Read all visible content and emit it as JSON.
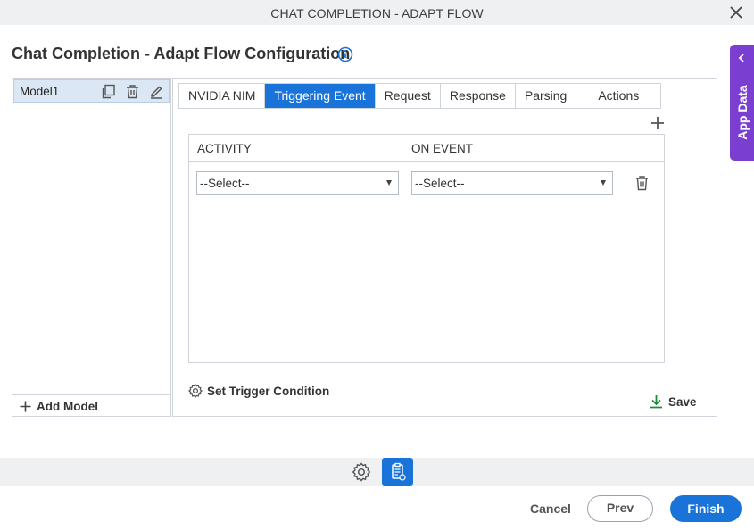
{
  "window": {
    "title": "CHAT COMPLETION - ADAPT FLOW",
    "close_icon": "close-icon"
  },
  "page": {
    "heading": "Chat Completion - Adapt Flow Configuration",
    "info_icon": "info-icon"
  },
  "side_tab": {
    "label": "App Data",
    "color": "#7a3fd1"
  },
  "models": {
    "items": [
      {
        "label": "Model1"
      }
    ],
    "add_label": "Add Model"
  },
  "tabs": [
    {
      "label": "NVIDIA NIM",
      "active": false
    },
    {
      "label": "Triggering Event",
      "active": true
    },
    {
      "label": "Request",
      "active": false
    },
    {
      "label": "Response",
      "active": false
    },
    {
      "label": "Parsing",
      "active": false
    },
    {
      "label": "Actions",
      "active": false
    }
  ],
  "grid": {
    "columns": [
      "ACTIVITY",
      "ON EVENT"
    ],
    "rows": [
      {
        "activity": "--Select--",
        "on_event": "--Select--"
      }
    ]
  },
  "actions": {
    "trigger_condition": "Set Trigger Condition",
    "save": "Save"
  },
  "footer": {
    "cancel": "Cancel",
    "prev": "Prev",
    "finish": "Finish"
  },
  "colors": {
    "accent": "#1a73d9",
    "app_data": "#7a3fd1",
    "save_icon": "#1e8a3a"
  }
}
